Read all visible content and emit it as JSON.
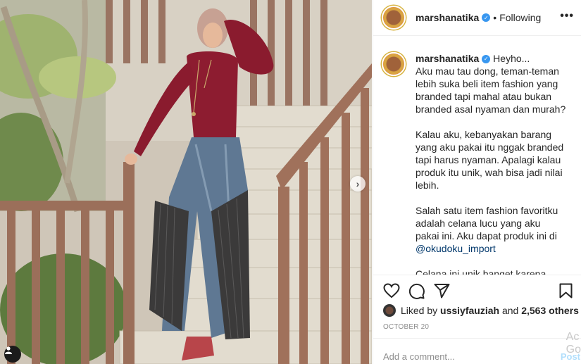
{
  "post": {
    "username": "marshanatika",
    "separator": "•",
    "follow_status": "Following",
    "more_glyph": "•••",
    "caption": {
      "username": "marshanatika",
      "greeting": "Heyho...",
      "paragraphs": [
        "Aku mau tau dong, teman-teman lebih suka beli item fashion yang branded tapi mahal atau bukan branded asal nyaman dan murah?",
        "Kalau aku, kebanyakan barang yang aku pakai itu nggak branded tapi harus nyaman. Apalagi kalau produk itu unik, wah bisa jadi nilai lebih.",
        "Salah satu item fashion favoritku adalah celana lucu yang aku pakai ini. Aku dapat produk ini di",
        "Celana ini unik banget karena perpaduan antara jeans sama bahan plits. Semua produk di"
      ],
      "mention": "@okudoku_import"
    },
    "likes": {
      "prefix": "Liked by",
      "user": "ussiyfauziah",
      "middle": "and",
      "others": "2,563 others"
    },
    "date": "OCTOBER 20",
    "comment": {
      "placeholder": "Add a comment...",
      "post_label": "Post"
    },
    "watermark": "Ac\nGo"
  },
  "icons": {
    "verified": "verified-badge-icon",
    "like": "heart-icon",
    "comment": "comment-icon",
    "share": "paper-plane-icon",
    "save": "bookmark-icon",
    "next": "chevron-right-icon",
    "tag": "user-tag-icon"
  },
  "colors": {
    "verified": "#3897f0",
    "text": "#262626",
    "muted": "#8e8e8e",
    "post_disabled": "#b2dffc",
    "mention": "#00376b"
  }
}
